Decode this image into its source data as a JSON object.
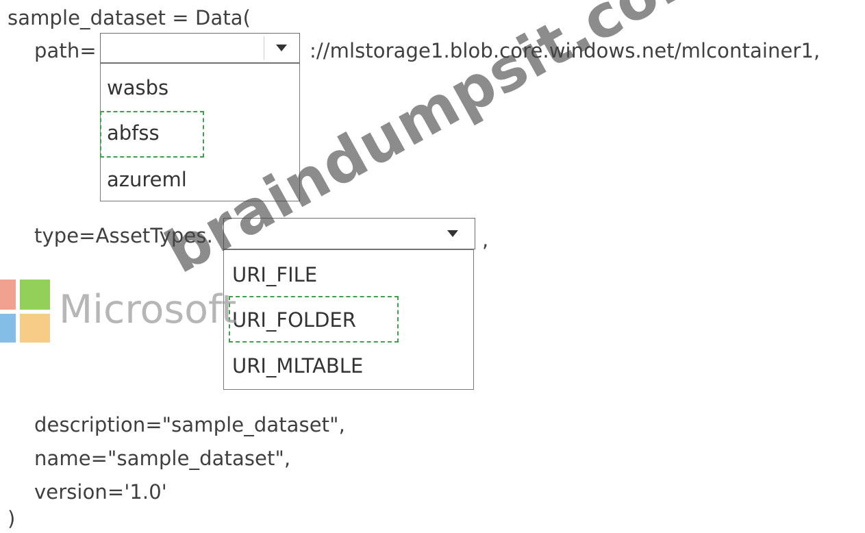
{
  "code": {
    "line1": "sample_dataset = Data(",
    "path_prefix": "path=",
    "path_suffix": "://mlstorage1.blob.core.windows.net/mlcontainer1,",
    "type_prefix": "type=AssetTypes.",
    "type_suffix": ",",
    "description": "description=\"sample_dataset\",",
    "name": "name=\"sample_dataset\",",
    "version": "version='1.0'",
    "close": ")"
  },
  "path_dropdown": {
    "selected": "",
    "options": [
      "wasbs",
      "abfss",
      "azureml"
    ],
    "highlighted_option": "abfss"
  },
  "type_dropdown": {
    "selected": "",
    "options": [
      "URI_FILE",
      "URI_FOLDER",
      "URI_MLTABLE"
    ],
    "highlighted_option": "URI_FOLDER"
  },
  "logo": {
    "text": "Microsoft",
    "colors": [
      "#f1a18f",
      "#93d05a",
      "#84bde6",
      "#f7cc86"
    ]
  },
  "watermark": {
    "text": "braindumpsit.com"
  },
  "colors": {
    "highlight_border": "#3ea04a",
    "code_text": "#3f3f3f"
  }
}
